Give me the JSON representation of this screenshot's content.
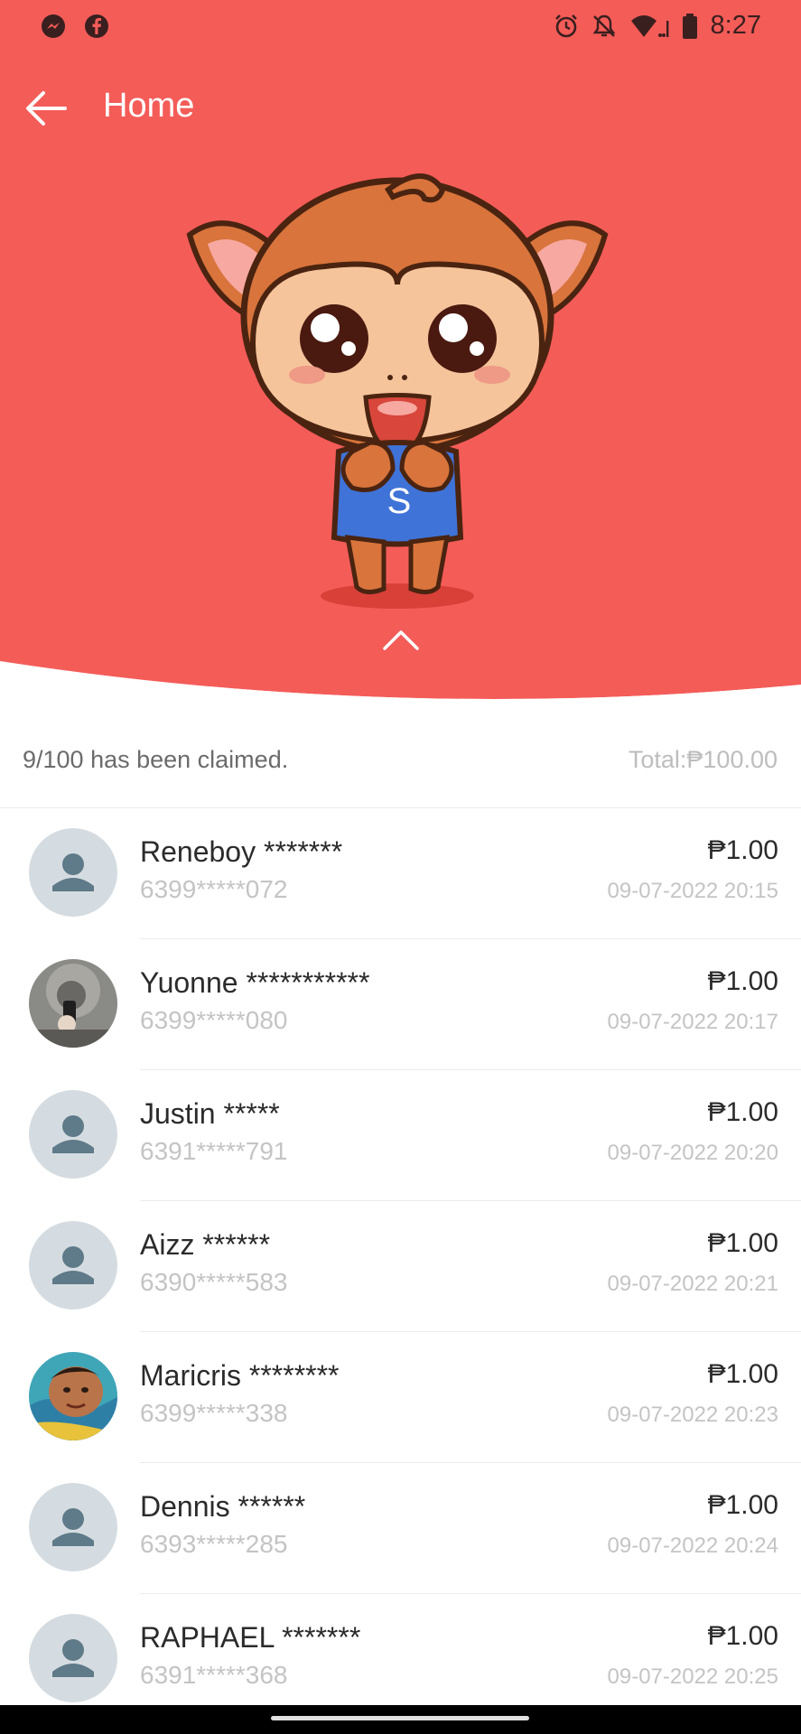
{
  "status_bar": {
    "time": "8:27",
    "left_icons": [
      "messenger-icon",
      "facebook-icon"
    ],
    "right_icons": [
      "alarm-icon",
      "notifications-off-icon",
      "wifi-icon",
      "battery-icon"
    ]
  },
  "header": {
    "title": "Home",
    "accent_color": "#f45c58"
  },
  "summary": {
    "claimed_text": "9/100 has been claimed.",
    "total_text": "Total:₱100.00"
  },
  "claims": [
    {
      "name": "Reneboy *******",
      "phone": "6399*****072",
      "amount": "₱1.00",
      "time": "09-07-2022 20:15",
      "avatar": "default"
    },
    {
      "name": "Yuonne ***********",
      "phone": "6399*****080",
      "amount": "₱1.00",
      "time": "09-07-2022 20:17",
      "avatar": "photo"
    },
    {
      "name": "Justin *****",
      "phone": "6391*****791",
      "amount": "₱1.00",
      "time": "09-07-2022 20:20",
      "avatar": "default"
    },
    {
      "name": "Aizz ******",
      "phone": "6390*****583",
      "amount": "₱1.00",
      "time": "09-07-2022 20:21",
      "avatar": "default"
    },
    {
      "name": "Maricris ********",
      "phone": "6399*****338",
      "amount": "₱1.00",
      "time": "09-07-2022 20:23",
      "avatar": "photo"
    },
    {
      "name": "Dennis ******",
      "phone": "6393*****285",
      "amount": "₱1.00",
      "time": "09-07-2022 20:24",
      "avatar": "default"
    },
    {
      "name": "RAPHAEL *******",
      "phone": "6391*****368",
      "amount": "₱1.00",
      "time": "09-07-2022 20:25",
      "avatar": "default"
    }
  ]
}
